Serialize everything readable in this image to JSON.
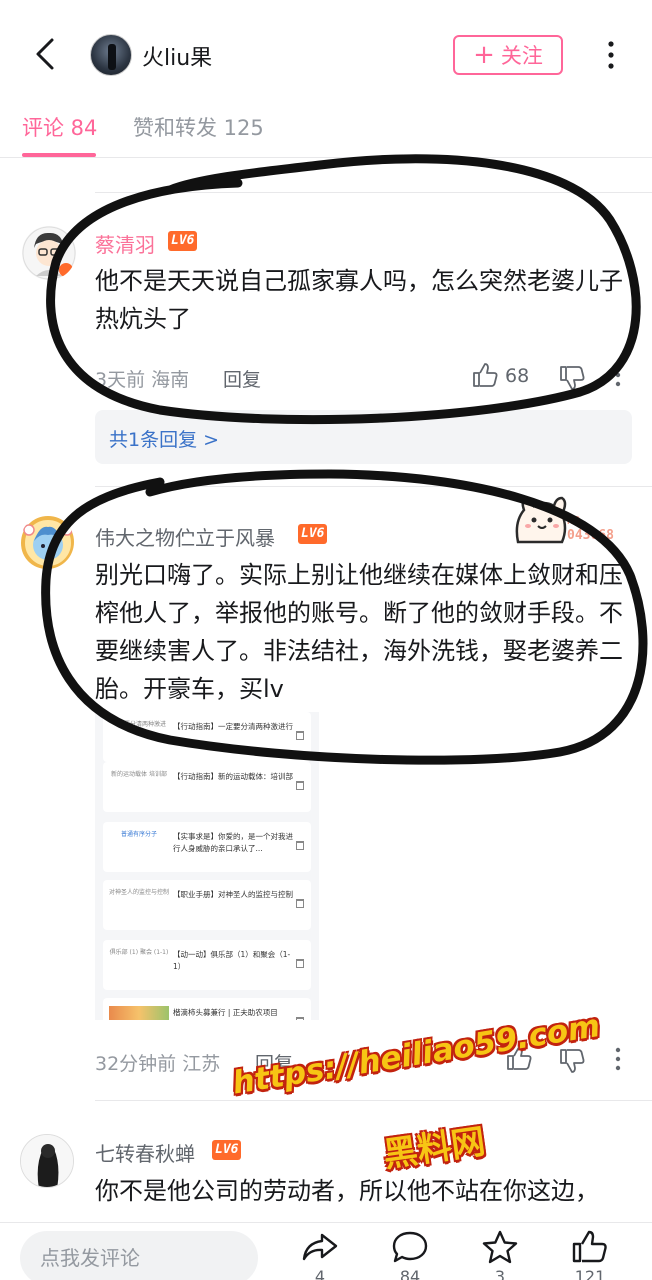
{
  "header": {
    "username": "火liu果",
    "follow_label": "关注",
    "follow_plus": "+"
  },
  "tabs": {
    "comments_label": "评论 84",
    "likes_label": "赞和转发 125"
  },
  "comments": [
    {
      "name": "蔡清羽",
      "level": "LV6",
      "text": "他不是天天说自己孤家寡人吗，怎么突然老婆儿子热炕头了",
      "time": "3天前 海南",
      "reply_label": "回复",
      "likes": "68",
      "replies_link": "共1条回复 >"
    },
    {
      "name": "伟大之物伫立于风暴",
      "level": "LV6",
      "sticker_label": "NO.",
      "sticker_number": "043068",
      "text": "别光口嗨了。实际上别让他继续在媒体上敛财和压榨他人了，举报他的账号。断了他的敛财手段。不要继续害人了。非法结社，海外洗钱，娶老婆养二胎。开豪车，买lv",
      "time": "32分钟前 江苏",
      "reply_label": "回复"
    },
    {
      "name": "七转春秋蝉",
      "level": "LV6",
      "text": "你不是他公司的劳动者，所以他不站在你这边，"
    }
  ],
  "embed_cards": [
    {
      "thumb": "一定要分清两种激进",
      "title": "【行动指南】一定要分清两种激进行"
    },
    {
      "thumb": "新的运动载体 培训部",
      "title": "【行动指南】新的运动载体：培训部"
    },
    {
      "thumb": "普通有序分子",
      "title": "【实事求是】你爱的，是一个对我进行人身威胁的亲口承认了..."
    },
    {
      "thumb": "对神圣人的监控与控制",
      "title": "【职业手册】对神圣人的监控与控制"
    },
    {
      "thumb": "俱乐部 (1) 聚会 (1-1)",
      "title": "【动一动】俱乐部（1）和聚会（1-1）"
    },
    {
      "thumb": "",
      "title": "楷滴柿头募兼行 | 正夫助农项目"
    }
  ],
  "watermark": {
    "url": "https://heiliao59.com",
    "name": "黑料网"
  },
  "bottom_bar": {
    "input_placeholder": "点我发评论",
    "share_count": "4",
    "comment_count": "84",
    "star_count": "3",
    "like_count": "121"
  },
  "colors": {
    "accent": "#ff6699",
    "level_badge": "#ff6a2b",
    "link": "#3a72c8",
    "muted": "#9499a0"
  }
}
